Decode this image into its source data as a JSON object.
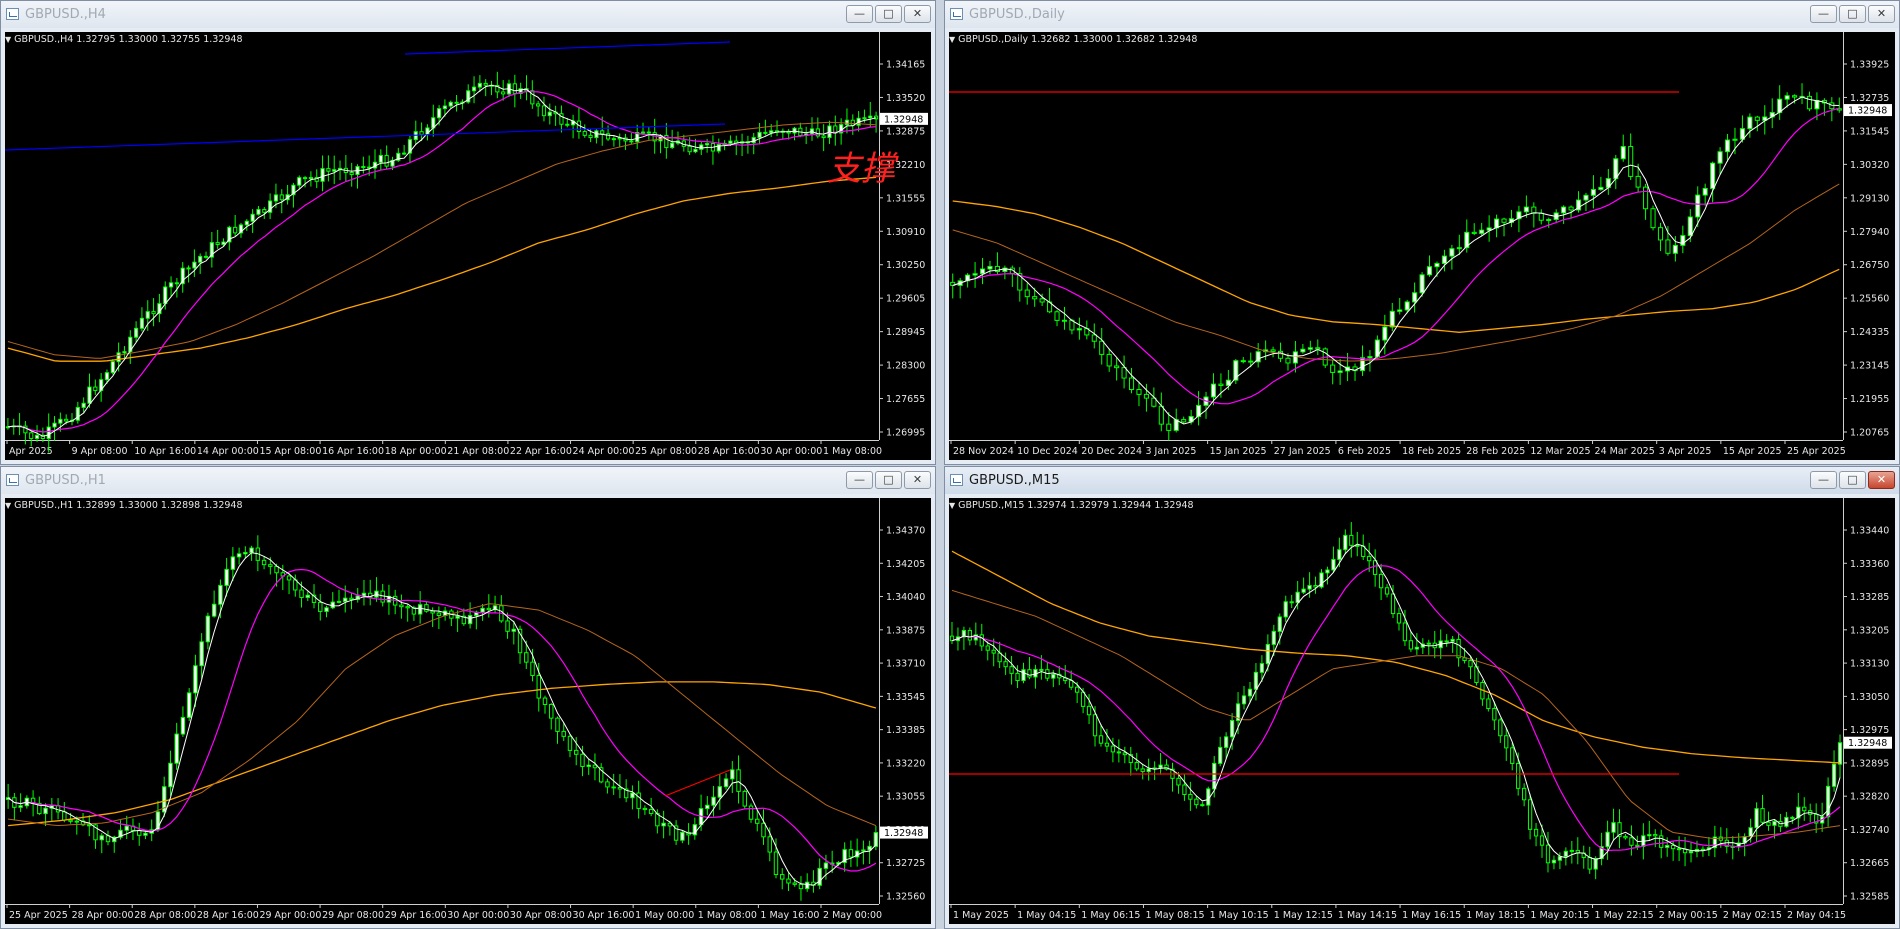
{
  "windows": [
    {
      "id": "h4",
      "title": "GBPUSD.,H4",
      "info": "GBPUSD.,H4  1.32795 1.33000 1.32755 1.32948",
      "current_price": "1.32948",
      "price_labels": [
        "1.34165",
        "1.33520",
        "1.32875",
        "1.32210",
        "1.31555",
        "1.30910",
        "1.30250",
        "1.29605",
        "1.28945",
        "1.28300",
        "1.27655",
        "1.26995"
      ],
      "time_labels": [
        "Apr 2025",
        "9 Apr 08:00",
        "10 Apr 16:00",
        "14 Apr 00:00",
        "15 Apr 08:00",
        "16 Apr 16:00",
        "18 Apr 00:00",
        "21 Apr 08:00",
        "22 Apr 16:00",
        "24 Apr 00:00",
        "25 Apr 08:00",
        "28 Apr 16:00",
        "30 Apr 00:00",
        "1 May 08:00"
      ],
      "annotation_text": "支撑"
    },
    {
      "id": "d1",
      "title": "GBPUSD.,Daily",
      "info": "GBPUSD.,Daily  1.32682 1.33000 1.32682 1.32948",
      "current_price": "1.32948",
      "price_labels": [
        "1.33925",
        "1.32735",
        "1.31545",
        "1.30320",
        "1.29130",
        "1.27940",
        "1.26750",
        "1.25560",
        "1.24335",
        "1.23145",
        "1.21955",
        "1.20765"
      ],
      "time_labels": [
        "28 Nov 2024",
        "10 Dec 2024",
        "20 Dec 2024",
        "3 Jan 2025",
        "15 Jan 2025",
        "27 Jan 2025",
        "6 Feb 2025",
        "18 Feb 2025",
        "28 Feb 2025",
        "12 Mar 2025",
        "24 Mar 2025",
        "3 Apr 2025",
        "15 Apr 2025",
        "25 Apr 2025"
      ]
    },
    {
      "id": "h1",
      "title": "GBPUSD.,H1",
      "info": "GBPUSD.,H1  1.32899 1.33000 1.32898 1.32948",
      "current_price": "1.32948",
      "price_labels": [
        "1.34370",
        "1.34205",
        "1.34040",
        "1.33875",
        "1.33710",
        "1.33545",
        "1.33385",
        "1.33220",
        "1.33055",
        "1.32890",
        "1.32725",
        "1.32560"
      ],
      "time_labels": [
        "25 Apr 2025",
        "28 Apr 00:00",
        "28 Apr 08:00",
        "28 Apr 16:00",
        "29 Apr 00:00",
        "29 Apr 08:00",
        "29 Apr 16:00",
        "30 Apr 00:00",
        "30 Apr 08:00",
        "30 Apr 16:00",
        "1 May 00:00",
        "1 May 08:00",
        "1 May 16:00",
        "2 May 00:00"
      ]
    },
    {
      "id": "m15",
      "title": "GBPUSD.,M15",
      "info": "GBPUSD.,M15  1.32974 1.32979 1.32944 1.32948",
      "current_price": "1.32948",
      "price_labels": [
        "1.33440",
        "1.33360",
        "1.33285",
        "1.33205",
        "1.33130",
        "1.33050",
        "1.32975",
        "1.32895",
        "1.32820",
        "1.32740",
        "1.32665",
        "1.32585"
      ],
      "time_labels": [
        "1 May 2025",
        "1 May 04:15",
        "1 May 06:15",
        "1 May 08:15",
        "1 May 10:15",
        "1 May 12:15",
        "1 May 14:15",
        "1 May 16:15",
        "1 May 18:15",
        "1 May 20:15",
        "1 May 22:15",
        "2 May 00:15",
        "2 May 02:15",
        "2 May 04:15"
      ]
    }
  ],
  "colors": {
    "background": "#000000",
    "bull_candle": "#ffffff",
    "candle_outline": "#00ff00",
    "ma_fast": "#ffffff",
    "ma_medium": "#ff00ff",
    "ma_slow": "#b5651d",
    "ma_long": "#ffa500",
    "channel_line": "#0000ff",
    "support_line": "#ff0000"
  }
}
